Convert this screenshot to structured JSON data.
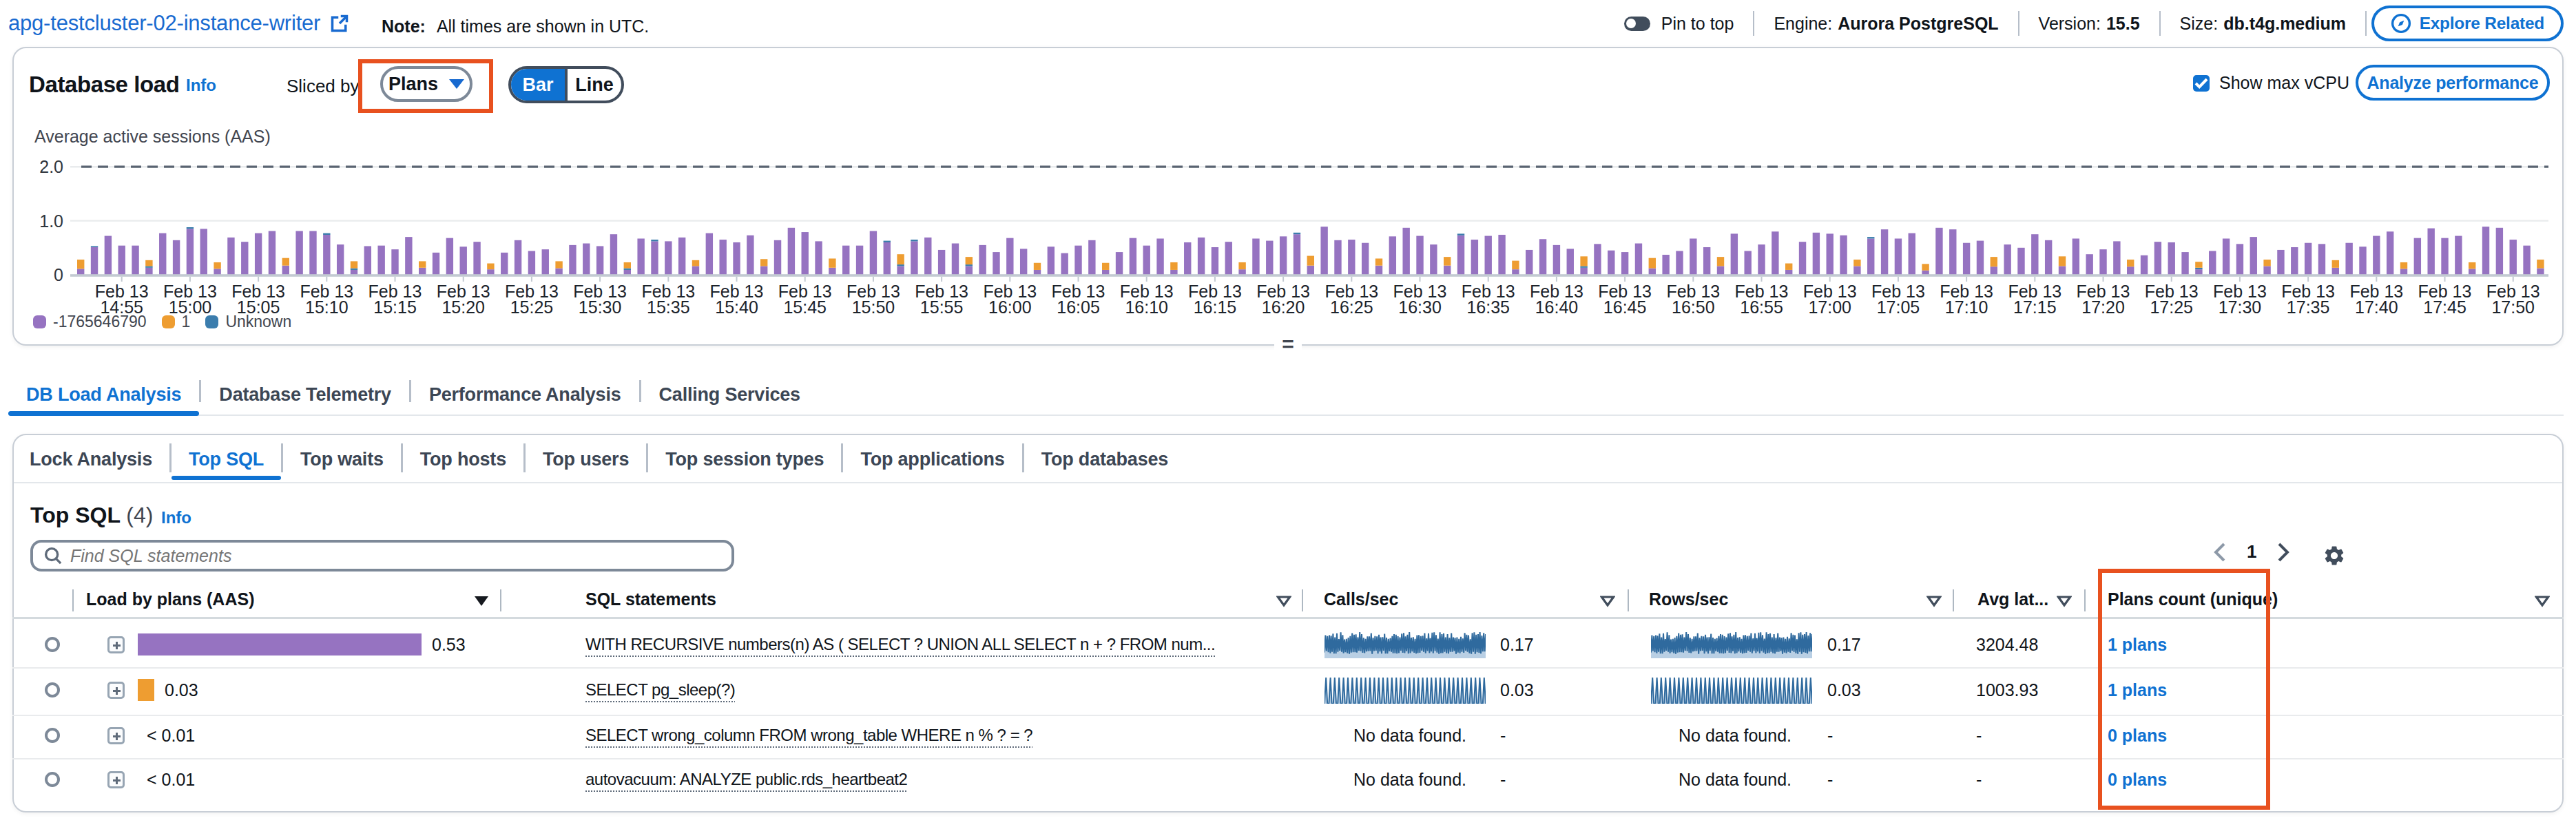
{
  "header": {
    "title": "apg-testcluster-02-instance-writer",
    "note_label": "Note:",
    "note_text": "All times are shown in UTC.",
    "pin_to_top": "Pin to top",
    "engine_label": "Engine:",
    "engine_value": "Aurora PostgreSQL",
    "version_label": "Version:",
    "version_value": "15.5",
    "size_label": "Size:",
    "size_value": "db.t4g.medium",
    "explore_related": "Explore Related"
  },
  "db_load": {
    "title": "Database load",
    "info": "Info",
    "sliced_by": "Sliced by",
    "slice_value": "Plans",
    "bar": "Bar",
    "line": "Line",
    "show_max_vcpu": "Show max vCPU",
    "analyze_performance": "Analyze performance"
  },
  "chart_data": {
    "type": "bar",
    "stacked": true,
    "title": "Database load",
    "ylabel": "Average active sessions (AAS)",
    "yticks": [
      0,
      1.0,
      2.0
    ],
    "ytick_labels": [
      "0",
      "1.0",
      "2.0"
    ],
    "ylim": [
      0,
      2.2
    ],
    "max_vcpu": 2.0,
    "interval_minutes": 1,
    "time_start": "Feb 13 14:52",
    "time_end": "Feb 13 17:52",
    "tick_date": "Feb 13",
    "tick_labels": [
      "14:55",
      "15:00",
      "15:05",
      "15:10",
      "15:15",
      "15:20",
      "15:25",
      "15:30",
      "15:35",
      "15:40",
      "15:45",
      "15:50",
      "15:55",
      "16:00",
      "16:05",
      "16:10",
      "16:15",
      "16:20",
      "16:25",
      "16:30",
      "16:35",
      "16:40",
      "16:45",
      "16:50",
      "16:55",
      "17:00",
      "17:05",
      "17:10",
      "17:15",
      "17:20",
      "17:25",
      "17:30",
      "17:35",
      "17:40",
      "17:45",
      "17:50"
    ],
    "legend": [
      {
        "label": "-1765646790",
        "color": "#9673c1"
      },
      {
        "label": "1",
        "color": "#ee9d31"
      },
      {
        "label": "Unknown",
        "color": "#3b7dad"
      }
    ],
    "series_order": [
      "-1765646790",
      "Unknown",
      "1"
    ],
    "bars": [
      [
        0.11,
        0,
        0.17
      ],
      [
        0.51,
        0.02,
        0
      ],
      [
        0.72,
        0,
        0
      ],
      [
        0.54,
        0,
        0
      ],
      [
        0.54,
        0,
        0
      ],
      [
        0.13,
        0.03,
        0.11
      ],
      [
        0.77,
        0,
        0
      ],
      [
        0.64,
        0,
        0
      ],
      [
        0.85,
        0.03,
        0
      ],
      [
        0.85,
        0,
        0
      ],
      [
        0.11,
        0,
        0.12
      ],
      [
        0.69,
        0,
        0
      ],
      [
        0.61,
        0,
        0
      ],
      [
        0.77,
        0,
        0
      ],
      [
        0.81,
        0,
        0
      ],
      [
        0.17,
        0,
        0.14
      ],
      [
        0.81,
        0,
        0
      ],
      [
        0.81,
        0,
        0
      ],
      [
        0.74,
        0.03,
        0
      ],
      [
        0.56,
        0,
        0
      ],
      [
        0.09,
        0.03,
        0.13
      ],
      [
        0.53,
        0,
        0
      ],
      [
        0.54,
        0,
        0
      ],
      [
        0.47,
        0,
        0
      ],
      [
        0.7,
        0,
        0
      ],
      [
        0.13,
        0,
        0.12
      ],
      [
        0.41,
        0,
        0
      ],
      [
        0.68,
        0,
        0
      ],
      [
        0.52,
        0,
        0
      ],
      [
        0.61,
        0,
        0
      ],
      [
        0.1,
        0,
        0.11
      ],
      [
        0.41,
        0,
        0
      ],
      [
        0.64,
        0,
        0
      ],
      [
        0.44,
        0,
        0
      ],
      [
        0.47,
        0,
        0
      ],
      [
        0.12,
        0,
        0.13
      ],
      [
        0.55,
        0,
        0
      ],
      [
        0.58,
        0,
        0
      ],
      [
        0.53,
        0,
        0
      ],
      [
        0.75,
        0,
        0
      ],
      [
        0.09,
        0.03,
        0.11
      ],
      [
        0.67,
        0,
        0
      ],
      [
        0.62,
        0.03,
        0
      ],
      [
        0.62,
        0,
        0
      ],
      [
        0.69,
        0,
        0
      ],
      [
        0.16,
        0,
        0.11
      ],
      [
        0.77,
        0,
        0
      ],
      [
        0.65,
        0,
        0
      ],
      [
        0.6,
        0,
        0
      ],
      [
        0.73,
        0,
        0
      ],
      [
        0.16,
        0,
        0.13
      ],
      [
        0.64,
        0,
        0
      ],
      [
        0.87,
        0,
        0
      ],
      [
        0.79,
        0,
        0
      ],
      [
        0.62,
        0,
        0
      ],
      [
        0.13,
        0,
        0.17
      ],
      [
        0.54,
        0,
        0
      ],
      [
        0.54,
        0,
        0
      ],
      [
        0.81,
        0,
        0
      ],
      [
        0.6,
        0.03,
        0
      ],
      [
        0.16,
        0.03,
        0.19
      ],
      [
        0.62,
        0.03,
        0
      ],
      [
        0.69,
        0,
        0
      ],
      [
        0.46,
        0,
        0
      ],
      [
        0.58,
        0,
        0
      ],
      [
        0.16,
        0.03,
        0.14
      ],
      [
        0.55,
        0,
        0
      ],
      [
        0.42,
        0,
        0
      ],
      [
        0.68,
        0,
        0
      ],
      [
        0.48,
        0,
        0
      ],
      [
        0.09,
        0,
        0.13
      ],
      [
        0.52,
        0,
        0
      ],
      [
        0.4,
        0,
        0
      ],
      [
        0.54,
        0,
        0
      ],
      [
        0.64,
        0,
        0
      ],
      [
        0.09,
        0,
        0.13
      ],
      [
        0.42,
        0,
        0
      ],
      [
        0.68,
        0,
        0
      ],
      [
        0.54,
        0,
        0
      ],
      [
        0.67,
        0,
        0
      ],
      [
        0.09,
        0,
        0.14
      ],
      [
        0.6,
        0,
        0
      ],
      [
        0.69,
        0,
        0
      ],
      [
        0.51,
        0,
        0
      ],
      [
        0.61,
        0,
        0
      ],
      [
        0.1,
        0,
        0.13
      ],
      [
        0.67,
        0,
        0
      ],
      [
        0.63,
        0,
        0
      ],
      [
        0.71,
        0,
        0
      ],
      [
        0.75,
        0.03,
        0
      ],
      [
        0.17,
        0,
        0.18
      ],
      [
        0.89,
        0,
        0
      ],
      [
        0.64,
        0,
        0
      ],
      [
        0.65,
        0,
        0
      ],
      [
        0.59,
        0,
        0
      ],
      [
        0.17,
        0,
        0.13
      ],
      [
        0.71,
        0,
        0
      ],
      [
        0.87,
        0,
        0
      ],
      [
        0.72,
        0,
        0
      ],
      [
        0.56,
        0,
        0
      ],
      [
        0.17,
        0,
        0.16
      ],
      [
        0.73,
        0.03,
        0
      ],
      [
        0.65,
        0,
        0
      ],
      [
        0.72,
        0,
        0
      ],
      [
        0.74,
        0,
        0
      ],
      [
        0.1,
        0,
        0.16
      ],
      [
        0.46,
        0,
        0
      ],
      [
        0.66,
        0,
        0
      ],
      [
        0.55,
        0,
        0
      ],
      [
        0.48,
        0,
        0
      ],
      [
        0.13,
        0.03,
        0.18
      ],
      [
        0.57,
        0,
        0
      ],
      [
        0.45,
        0,
        0
      ],
      [
        0.42,
        0,
        0
      ],
      [
        0.58,
        0,
        0
      ],
      [
        0.12,
        0,
        0.19
      ],
      [
        0.37,
        0,
        0
      ],
      [
        0.44,
        0,
        0
      ],
      [
        0.67,
        0,
        0
      ],
      [
        0.51,
        0,
        0
      ],
      [
        0.16,
        0,
        0.17
      ],
      [
        0.76,
        0,
        0
      ],
      [
        0.44,
        0,
        0
      ],
      [
        0.56,
        0,
        0
      ],
      [
        0.8,
        0,
        0
      ],
      [
        0.09,
        0,
        0.12
      ],
      [
        0.61,
        0,
        0
      ],
      [
        0.78,
        0,
        0
      ],
      [
        0.76,
        0,
        0
      ],
      [
        0.73,
        0,
        0
      ],
      [
        0.16,
        0,
        0.12
      ],
      [
        0.67,
        0.03,
        0
      ],
      [
        0.84,
        0,
        0
      ],
      [
        0.67,
        0,
        0
      ],
      [
        0.77,
        0,
        0
      ],
      [
        0.08,
        0,
        0.12
      ],
      [
        0.87,
        0,
        0
      ],
      [
        0.84,
        0,
        0
      ],
      [
        0.59,
        0,
        0
      ],
      [
        0.63,
        0,
        0
      ],
      [
        0.15,
        0,
        0.18
      ],
      [
        0.56,
        0,
        0
      ],
      [
        0.5,
        0,
        0
      ],
      [
        0.75,
        0,
        0
      ],
      [
        0.64,
        0,
        0
      ],
      [
        0.16,
        0,
        0.18
      ],
      [
        0.67,
        0,
        0
      ],
      [
        0.38,
        0,
        0
      ],
      [
        0.47,
        0,
        0
      ],
      [
        0.62,
        0,
        0
      ],
      [
        0.15,
        0,
        0.13
      ],
      [
        0.36,
        0,
        0
      ],
      [
        0.61,
        0,
        0
      ],
      [
        0.6,
        0,
        0
      ],
      [
        0.42,
        0,
        0
      ],
      [
        0.1,
        0.03,
        0.11
      ],
      [
        0.44,
        0,
        0
      ],
      [
        0.67,
        0,
        0
      ],
      [
        0.57,
        0,
        0
      ],
      [
        0.7,
        0,
        0
      ],
      [
        0.16,
        0,
        0.12
      ],
      [
        0.46,
        0,
        0
      ],
      [
        0.51,
        0,
        0
      ],
      [
        0.59,
        0,
        0
      ],
      [
        0.57,
        0,
        0
      ],
      [
        0.13,
        0,
        0.14
      ],
      [
        0.59,
        0,
        0
      ],
      [
        0.52,
        0,
        0
      ],
      [
        0.72,
        0,
        0
      ],
      [
        0.8,
        0,
        0
      ],
      [
        0.11,
        0,
        0.12
      ],
      [
        0.68,
        0,
        0
      ],
      [
        0.86,
        0,
        0
      ],
      [
        0.68,
        0,
        0
      ],
      [
        0.72,
        0,
        0
      ],
      [
        0.11,
        0,
        0.12
      ],
      [
        0.89,
        0,
        0
      ],
      [
        0.87,
        0,
        0
      ],
      [
        0.65,
        0,
        0
      ],
      [
        0.54,
        0,
        0
      ],
      [
        0.12,
        0,
        0.16
      ]
    ]
  },
  "tabs": [
    "DB Load Analysis",
    "Database Telemetry",
    "Performance Analysis",
    "Calling Services"
  ],
  "active_tab": "DB Load Analysis",
  "subtabs": [
    "Lock Analysis",
    "Top SQL",
    "Top waits",
    "Top hosts",
    "Top users",
    "Top session types",
    "Top applications",
    "Top databases"
  ],
  "active_subtab": "Top SQL",
  "top_sql": {
    "title": "Top SQL",
    "count": "(4)",
    "info": "Info",
    "search_placeholder": "Find SQL statements",
    "page": "1",
    "columns": [
      "Load by plans (AAS)",
      "SQL statements",
      "Calls/sec",
      "Rows/sec",
      "Avg lat...",
      "Plans count (unique)"
    ],
    "no_data_text": "No data found.",
    "dash": "-",
    "rows": [
      {
        "load": "0.53",
        "load_aas": 0.53,
        "load_color": "#9673c1",
        "sql": "WITH RECURSIVE numbers(n) AS ( SELECT ? UNION ALL SELECT n + ? FROM num...",
        "calls": "0.17",
        "rows": "0.17",
        "avg_latency": "3204.48",
        "plans": "1 plans",
        "spark": "dense"
      },
      {
        "load": "0.03",
        "load_aas": 0.03,
        "load_color": "#ee9d31",
        "sql": "SELECT pg_sleep(?)",
        "calls": "0.03",
        "rows": "0.03",
        "avg_latency": "1003.93",
        "plans": "1 plans",
        "spark": "comb"
      },
      {
        "load": "< 0.01",
        "sql": "SELECT wrong_column FROM wrong_table WHERE n % ? = ?",
        "avg_latency": "-",
        "plans": "0 plans"
      },
      {
        "load": "< 0.01",
        "sql": "autovacuum: ANALYZE public.rds_heartbeat2",
        "avg_latency": "-",
        "plans": "0 plans"
      }
    ],
    "spark_dense": [
      0.22,
      0.88,
      0.28,
      0.85,
      0.23,
      0.88,
      0.19,
      0.86,
      0.25,
      0.94,
      0.18,
      0.8,
      0.18,
      0.95,
      0.25,
      0.73,
      0.29,
      0.99,
      0.25,
      0.89,
      0.19,
      0.72,
      0.23,
      0.74,
      0.19,
      0.79,
      0.17,
      0.85,
      0.22,
      0.96,
      0.23,
      0.9,
      0.23,
      0.91,
      0.22,
      0.8,
      0.29,
      1.0,
      0.27,
      0.92,
      0.21,
      0.78,
      0.2,
      0.74,
      0.26,
      0.83,
      0.27,
      0.83,
      0.28,
      0.96,
      0.17,
      0.78,
      0.28,
      0.85,
      0.29,
      0.83,
      0.18,
      0.9,
      0.26,
      0.8,
      0.18,
      0.81,
      0.29,
      0.93,
      0.18,
      0.79,
      0.18,
      0.74,
      0.27,
      0.77,
      0.24,
      0.85,
      0.19,
      0.92,
      0.19,
      0.9,
      0.18,
      0.84,
      0.2,
      0.8,
      0.29,
      0.94,
      0.21,
      0.97,
      0.2,
      0.83,
      0.27,
      0.9,
      0.18,
      1.0,
      0.2,
      0.79,
      0.26,
      0.81,
      0.21,
      0.74,
      0.18,
      0.88,
      0.2,
      0.89,
      0.21,
      0.85,
      0.29,
      0.86,
      0.24,
      0.96,
      0.19,
      0.76,
      0.28,
      0.95,
      0.2,
      0.77,
      0.26,
      0.98,
      0.19,
      0.99,
      0.28,
      0.89,
      0.22,
      0.75,
      0.17,
      0.99,
      0.2,
      0.92,
      0.2,
      0.95,
      0.24,
      0.8,
      0.19,
      0.92,
      0.18,
      0.78,
      0.24,
      0.96,
      0.24,
      0.8,
      0.28,
      0.78,
      0.17,
      0.8,
      0.22,
      0.74,
      0.19,
      0.82,
      0.24,
      0.76,
      0.21,
      0.97,
      0.29,
      0.9,
      0.25,
      0.88,
      0.19,
      0.73,
      0.17,
      0.97,
      0.25,
      0.99,
      0.17,
      0.9,
      0.23,
      0.92,
      0.21,
      1.0,
      0.18,
      0.87,
      0.26,
      0.97,
      0.26,
      0.92
    ],
    "spark_comb": [
      0.0,
      1.0,
      0.0,
      0.0,
      1.0,
      0.0,
      0.0,
      1.0,
      0.0,
      0.0,
      1.0,
      0.0,
      0.0,
      1.0,
      0.0,
      0.0,
      1.0,
      0.0,
      0.0,
      1.0,
      0.0,
      0.0,
      1.0,
      0.0,
      0.0,
      1.0,
      0.0,
      0.0,
      1.0,
      0.0,
      0.0,
      1.0,
      0.0,
      0.0,
      1.0,
      0.0,
      0.0,
      1.0,
      0.0,
      0.0,
      1.0,
      0.0,
      0.0,
      1.0,
      0.0,
      0.0,
      1.0,
      0.0,
      0.0,
      1.0,
      0.0,
      0.0,
      1.0,
      0.0,
      0.0,
      1.0,
      0.0,
      0.0,
      1.0,
      0.0,
      0.0,
      1.0,
      0.0,
      0.0,
      1.0,
      0.0,
      0.0,
      1.0,
      0.0,
      0.0,
      1.0,
      0.0,
      0.0,
      1.0,
      0.0,
      0.0,
      1.0,
      0.0,
      0.0,
      1.0,
      0.0,
      0.0,
      1.0,
      0.0,
      0.0,
      1.0,
      0.0,
      0.0,
      1.0,
      0.0,
      0.0,
      1.0,
      0.0,
      0.0,
      1.0,
      0.0,
      0.0,
      1.0,
      0.0,
      0.0,
      1.0,
      0.0,
      0.0,
      1.0,
      0.0,
      0.0,
      1.0,
      0.0,
      0.0,
      1.0,
      0.0
    ]
  },
  "annotation_color": "#e8511f"
}
